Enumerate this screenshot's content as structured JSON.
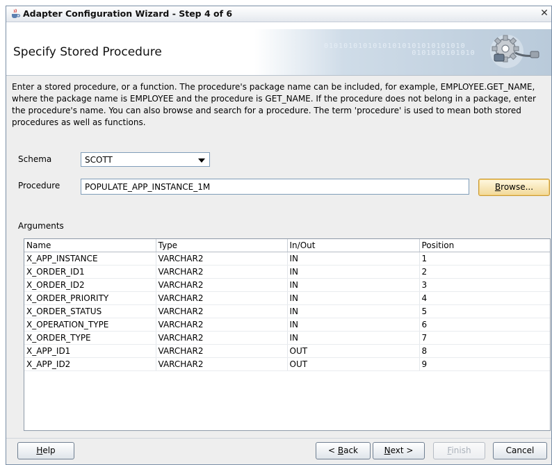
{
  "window": {
    "title": "Adapter Configuration Wizard - Step 4 of 6",
    "close_glyph": "✕",
    "icon": "coffee-cup-icon"
  },
  "header": {
    "title": "Specify Stored Procedure",
    "banner_bits": "01010101010101010101010101010\n                  0101010101010",
    "graphic": "gear-plug-icon"
  },
  "description": "Enter a stored procedure, or a function. The procedure's package name can be included, for example, EMPLOYEE.GET_NAME, where the package name is EMPLOYEE and the procedure is GET_NAME.  If the procedure does not belong in a package, enter the procedure's name. You can also browse and search for a procedure. The term 'procedure' is used to mean both stored procedures as well as functions.",
  "schema": {
    "label": "Schema",
    "value": "SCOTT"
  },
  "procedure": {
    "label": "Procedure",
    "value": "POPULATE_APP_INSTANCE_1M"
  },
  "browse_button": {
    "mnemonic": "B",
    "rest": "rowse..."
  },
  "arguments": {
    "label": "Arguments",
    "columns": [
      "Name",
      "Type",
      "In/Out",
      "Position"
    ],
    "rows": [
      [
        "X_APP_INSTANCE",
        "VARCHAR2",
        "IN",
        "1"
      ],
      [
        "X_ORDER_ID1",
        "VARCHAR2",
        "IN",
        "2"
      ],
      [
        "X_ORDER_ID2",
        "VARCHAR2",
        "IN",
        "3"
      ],
      [
        "X_ORDER_PRIORITY",
        "VARCHAR2",
        "IN",
        "4"
      ],
      [
        "X_ORDER_STATUS",
        "VARCHAR2",
        "IN",
        "5"
      ],
      [
        "X_OPERATION_TYPE",
        "VARCHAR2",
        "IN",
        "6"
      ],
      [
        "X_ORDER_TYPE",
        "VARCHAR2",
        "IN",
        "7"
      ],
      [
        "X_APP_ID1",
        "VARCHAR2",
        "OUT",
        "8"
      ],
      [
        "X_APP_ID2",
        "VARCHAR2",
        "OUT",
        "9"
      ]
    ]
  },
  "buttons": {
    "help": {
      "mnemonic": "H",
      "rest": "elp"
    },
    "back": {
      "pre": "< ",
      "mnemonic": "B",
      "rest": "ack"
    },
    "next": {
      "mnemonic": "N",
      "rest": "ext >"
    },
    "finish": {
      "mnemonic": "F",
      "rest": "inish",
      "enabled": false
    },
    "cancel": {
      "label": "Cancel"
    }
  },
  "colors": {
    "focus_button": "#f1d898",
    "border": "#7f9db9",
    "banner": "#b9cada"
  }
}
